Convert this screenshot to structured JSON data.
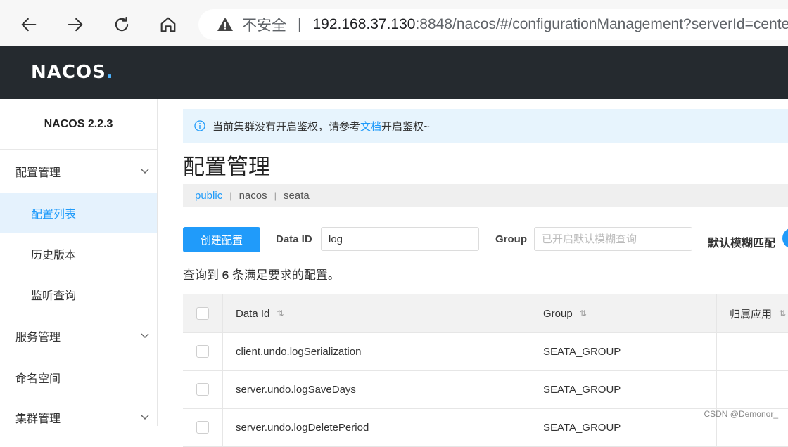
{
  "browser": {
    "insecure_label": "不安全",
    "url_host": "192.168.37.130",
    "url_rest": ":8848/nacos/#/configurationManagement?serverId=cente"
  },
  "app": {
    "logo_text": "NACOS",
    "logo_dot": "."
  },
  "sidebar": {
    "version": "NACOS 2.2.3",
    "items": [
      {
        "label": "配置管理",
        "expandable": true
      },
      {
        "label": "配置列表",
        "active": true
      },
      {
        "label": "历史版本"
      },
      {
        "label": "监听查询"
      },
      {
        "label": "服务管理",
        "expandable": true
      },
      {
        "label": "命名空间"
      },
      {
        "label": "集群管理",
        "expandable": true
      }
    ]
  },
  "notice": {
    "text_before": "当前集群没有开启鉴权，请参考",
    "link": "文档",
    "text_after": "开启鉴权~"
  },
  "page_title": "配置管理",
  "namespaces": [
    "public",
    "nacos",
    "seata"
  ],
  "toolbar": {
    "create_label": "创建配置",
    "data_id_label": "Data ID",
    "data_id_value": "log",
    "group_label": "Group",
    "group_placeholder": "已开启默认模糊查询",
    "fuzzy_label": "默认模糊匹配"
  },
  "result": {
    "prefix": "查询到",
    "count": "6",
    "suffix": "条满足要求的配置。"
  },
  "table": {
    "headers": [
      "Data Id",
      "Group",
      "归属应用"
    ],
    "rows": [
      {
        "data_id": "client.undo.logSerialization",
        "group": "SEATA_GROUP"
      },
      {
        "data_id": "server.undo.logSaveDays",
        "group": "SEATA_GROUP"
      },
      {
        "data_id": "server.undo.logDeletePeriod",
        "group": "SEATA_GROUP"
      }
    ]
  },
  "watermark": "CSDN @Demonor_"
}
